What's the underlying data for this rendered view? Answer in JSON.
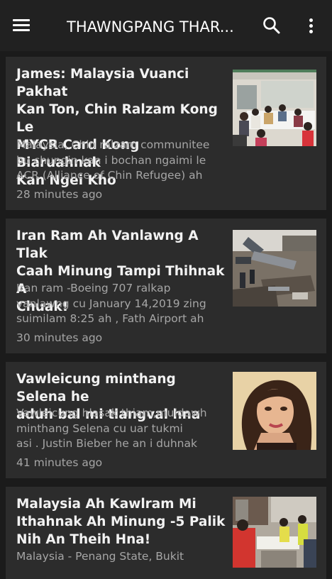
{
  "app": {
    "title": "THAWNGPANG THAR...",
    "menu_icon": "menu-icon",
    "search_icon": "search-icon",
    "more_icon": "more-vert-icon"
  },
  "colors": {
    "background": "#1b1b1b",
    "appbar": "#212121",
    "card": "#2c2c2c",
    "title_text": "#f2f2f2",
    "secondary_text": "#a6a6a6"
  },
  "articles": [
    {
      "title_lines": [
        "James: Malaysia Vuanci Pakhat",
        "Kan Ton, Chin Ralzam Kong Le",
        "MYCR Card Kong Biaruahnak",
        "Kan Ngei Kho"
      ],
      "desc_lines": [
        "Malaysia, Chin ralzam communitee",
        "bu chungin kan i bochan ngaimi le",
        "ACR (Alliance of Chin Refugee) ah"
      ],
      "time": "28 minutes ago"
    },
    {
      "title_lines": [
        "Iran Ram Ah  Vanlawng A Tlak",
        "Caah  Minung  Tampi Thihnak  A",
        "Chuak!"
      ],
      "desc_lines": [
        "Iran ram -Boeing 707 ralkap",
        "vanlawng cu January 14,2019 zing",
        "suimilam 8:25 ah , Fath Airport ah"
      ],
      "time": "30 minutes ago"
    },
    {
      "title_lines": [
        "Vawleicung minthang Selena he",
        "aduh bal mi tlangval hna"
      ],
      "desc_lines": [
        "Vawleicung hlasak thiam,muidawh",
        "minthang Selena cu uar tukmi",
        "asi . Justin Bieber he an i duhnak"
      ],
      "time": "41 minutes ago"
    },
    {
      "title_lines": [
        "Malaysia Ah  Kawlram Mi",
        "Ithahnak Ah  Minung -5 Palik",
        "Nih An  Theih Hna!"
      ],
      "desc_lines": [
        "Malaysia - Penang State, Bukit"
      ],
      "time": ""
    }
  ]
}
